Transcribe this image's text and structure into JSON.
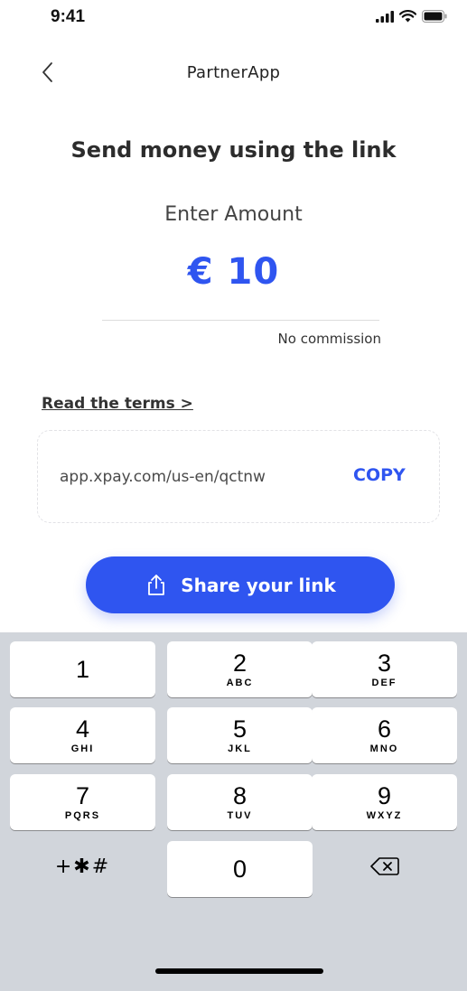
{
  "status_bar": {
    "time": "9:41",
    "icons": [
      "signal-icon",
      "wifi-icon",
      "battery-icon"
    ]
  },
  "nav": {
    "back_icon": "chevron-left-icon",
    "title": "PartnerApp"
  },
  "main": {
    "heading": "Send money using the link",
    "amount_label": "Enter Amount",
    "amount": "€ 10",
    "commission": "No commission",
    "terms_link": "Read the terms >",
    "link_url": "app.xpay.com/us-en/qctnw",
    "copy_label": "COPY",
    "share_label": "Share your link",
    "share_icon": "share-icon"
  },
  "keypad": {
    "keys": [
      {
        "num": "1",
        "letters": ""
      },
      {
        "num": "2",
        "letters": "ABC"
      },
      {
        "num": "3",
        "letters": "DEF"
      },
      {
        "num": "4",
        "letters": "GHI"
      },
      {
        "num": "5",
        "letters": "JKL"
      },
      {
        "num": "6",
        "letters": "MNO"
      },
      {
        "num": "7",
        "letters": "PQRS"
      },
      {
        "num": "8",
        "letters": "TUV"
      },
      {
        "num": "9",
        "letters": "WXYZ"
      },
      {
        "num": "0",
        "letters": ""
      }
    ],
    "symbols": "+✱#",
    "delete_icon": "backspace-icon"
  },
  "colors": {
    "accent": "#2f55f0",
    "keypad_bg": "#d1d5db"
  }
}
